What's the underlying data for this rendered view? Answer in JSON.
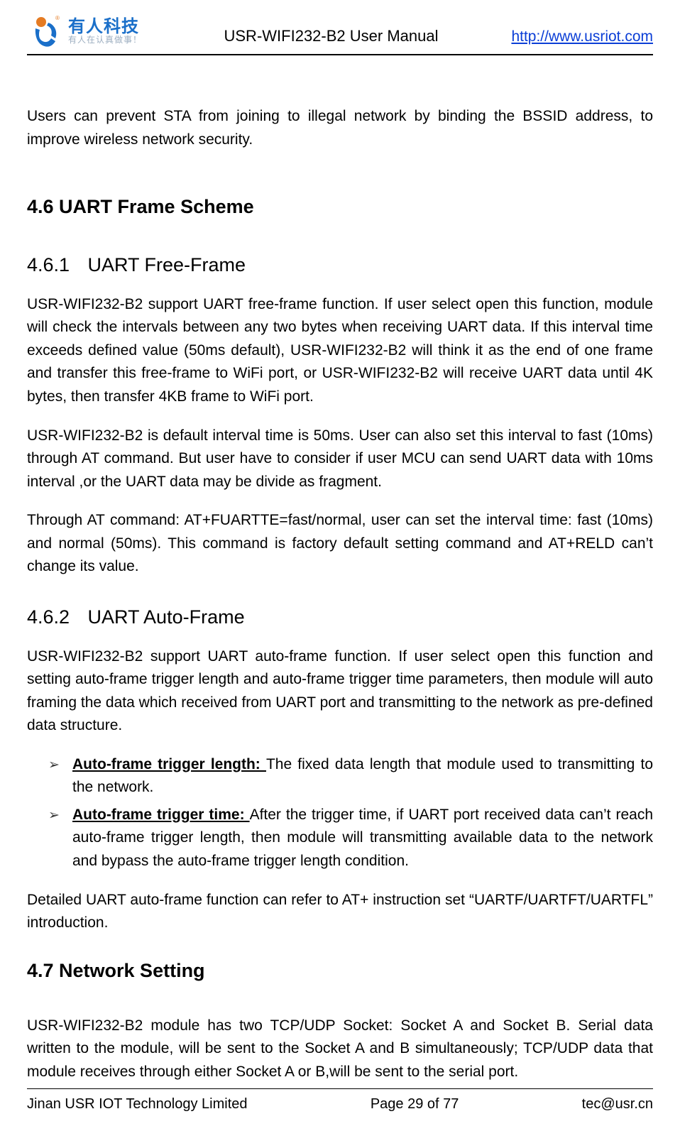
{
  "header": {
    "logo_cn": "有人科技",
    "logo_tag": "有人在认真做事！",
    "title": "USR-WIFI232-B2 User Manual",
    "link_text": "http://www.usriot.com",
    "link_href": "http://www.usriot.com"
  },
  "intro_paragraph": "Users can prevent STA from joining to illegal network by binding the BSSID address, to improve wireless network security.",
  "section_4_6": {
    "heading": "4.6 UART Frame Scheme",
    "sub1": {
      "num": "4.6.1",
      "title": "UART Free-Frame",
      "p1": "USR-WIFI232-B2 support UART free-frame function. If user select open this function, module will check the intervals between any two bytes when receiving UART data. If this interval time exceeds defined value (50ms default), USR-WIFI232-B2 will think it as the end of one frame and transfer this free-frame to WiFi port, or USR-WIFI232-B2 will receive UART data until 4K bytes, then transfer 4KB frame to WiFi port.",
      "p2": "USR-WIFI232-B2 is default interval time is 50ms. User can also set this interval to fast (10ms) through AT command. But user have to consider if user MCU can send UART data with 10ms interval ,or the UART data may be divide as fragment.",
      "p3": "Through AT command: AT+FUARTTE=fast/normal, user can set the interval time: fast (10ms) and normal (50ms). This command is factory default setting command and AT+RELD can’t change its value."
    },
    "sub2": {
      "num": "4.6.2",
      "title": "UART Auto-Frame",
      "p1": "USR-WIFI232-B2 support UART auto-frame function. If user select open this function and setting auto-frame trigger length and auto-frame trigger time parameters, then module will auto framing the data which received from UART port and transmitting to the network as pre-defined data structure.",
      "bullet1_label": "Auto-frame trigger length: ",
      "bullet1_text": "The fixed data length that module used to transmitting to the network.",
      "bullet2_label": "Auto-frame trigger time: ",
      "bullet2_text": "After the trigger time, if UART port received data can’t reach auto-frame trigger length, then module will transmitting available data to the network and bypass the auto-frame trigger length condition.",
      "p2": "Detailed UART auto-frame function can refer to AT+ instruction set “UARTF/UARTFT/UARTFL” introduction."
    }
  },
  "section_4_7": {
    "heading": "4.7 Network Setting",
    "p1": "USR-WIFI232-B2 module has two TCP/UDP Socket: Socket A and Socket B. Serial data written to the module, will be sent to the Socket A and B simultaneously; TCP/UDP data that module receives through either Socket A or B,will be sent to the serial port."
  },
  "footer": {
    "left": "Jinan USR IOT Technology Limited",
    "center": "Page 29 of 77",
    "right": "tec@usr.cn"
  }
}
